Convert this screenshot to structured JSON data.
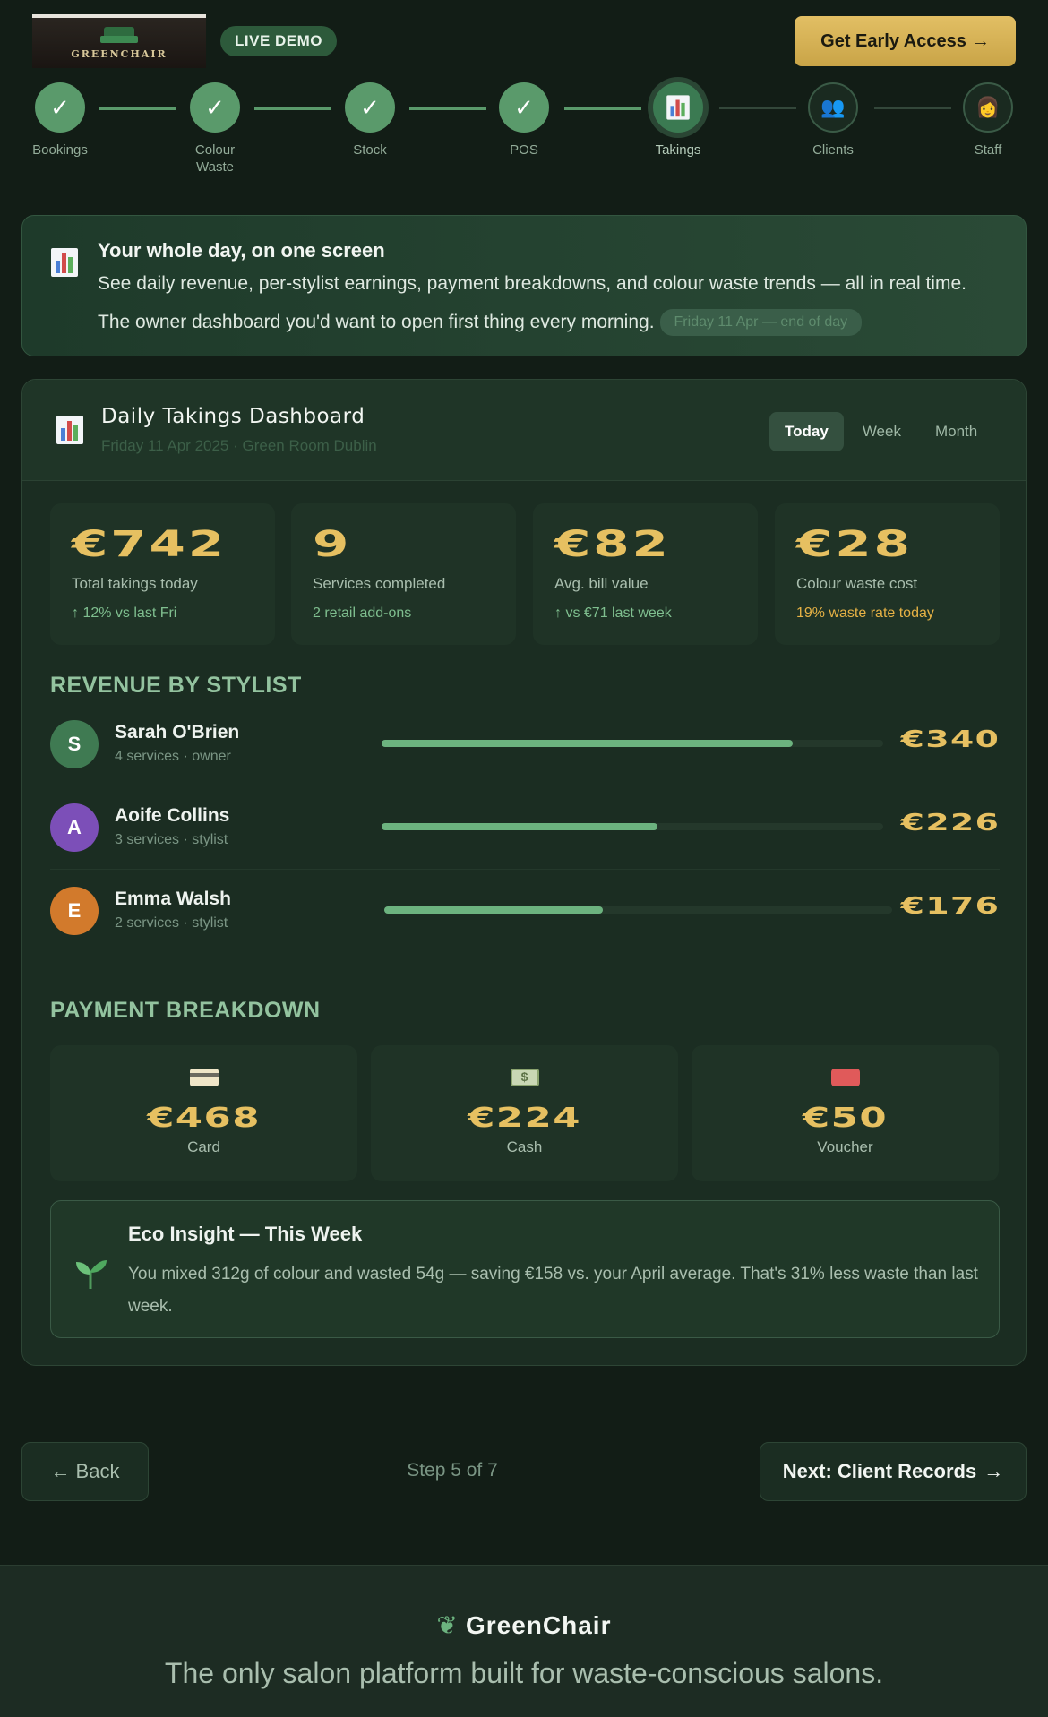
{
  "header": {
    "logo_text": "GREENCHAIR",
    "live_badge": "LIVE DEMO",
    "cta_label": "Get Early Access",
    "cta_arrow": "→"
  },
  "stepper": {
    "steps": [
      {
        "label": "Bookings",
        "state": "done",
        "icon": "✓"
      },
      {
        "label": "Colour Waste",
        "state": "done",
        "icon": "✓"
      },
      {
        "label": "Stock",
        "state": "done",
        "icon": "✓"
      },
      {
        "label": "POS",
        "state": "done",
        "icon": "✓"
      },
      {
        "label": "Takings",
        "state": "active",
        "icon": "bar-chart-icon"
      },
      {
        "label": "Clients",
        "state": "todo",
        "icon": "👥"
      },
      {
        "label": "Staff",
        "state": "todo",
        "icon": "👩"
      }
    ]
  },
  "intro": {
    "title": "Your whole day, on one screen",
    "line1": "See daily revenue, per-stylist earnings, payment breakdowns, and colour waste trends — all in real time.",
    "line2": "The owner dashboard you'd want to open first thing every morning.",
    "date_chip": "Friday 11 Apr — end of day"
  },
  "dashboard": {
    "title": "Daily Takings Dashboard",
    "subtitle": "Friday 11 Apr 2025 · Green Room Dublin",
    "tabs": [
      "Today",
      "Week",
      "Month"
    ],
    "active_tab": "Today",
    "stats": [
      {
        "value": "€742",
        "label": "Total takings today",
        "sub": "↑ 12% vs last Fri"
      },
      {
        "value": "9",
        "label": "Services completed",
        "sub": "2 retail add-ons"
      },
      {
        "value": "€82",
        "label": "Avg. bill value",
        "sub": "↑ vs €71 last week"
      },
      {
        "value": "€28",
        "label": "Colour waste cost",
        "sub": "19% waste rate today"
      }
    ],
    "revenue_title": "REVENUE BY STYLIST",
    "stylists": [
      {
        "initial": "S",
        "name": "Sarah O'Brien",
        "meta": "4 services · owner",
        "amount": "€340",
        "share": 0.82,
        "color": "#3f7a52"
      },
      {
        "initial": "A",
        "name": "Aoife Collins",
        "meta": "3 services · stylist",
        "amount": "€226",
        "share": 0.55,
        "color": "#7c4fb8"
      },
      {
        "initial": "E",
        "name": "Emma Walsh",
        "meta": "2 services · stylist",
        "amount": "€176",
        "share": 0.43,
        "color": "#d27a2c"
      }
    ],
    "payment_title": "PAYMENT BREAKDOWN",
    "payments": [
      {
        "icon": "credit-card-icon",
        "value": "€468",
        "label": "Card"
      },
      {
        "icon": "cash-icon",
        "value": "€224",
        "label": "Cash"
      },
      {
        "icon": "voucher-icon",
        "value": "€50",
        "label": "Voucher"
      }
    ],
    "eco": {
      "title": "Eco Insight — This Week",
      "text": "You mixed 312g of colour and wasted 54g — saving €158 vs. your April average. That's 31% less waste than last week."
    }
  },
  "nav": {
    "back_label": "Back",
    "back_arrow": "←",
    "step_count": "Step 5 of 7",
    "next_label": "Next: Client Records",
    "next_arrow": "→"
  },
  "footer": {
    "brand": "GreenChair",
    "tagline": "The only salon platform built for waste-conscious salons."
  },
  "colors": {
    "accent_gold": "#e6c061",
    "accent_green": "#6cb37f",
    "background": "#121d16"
  }
}
